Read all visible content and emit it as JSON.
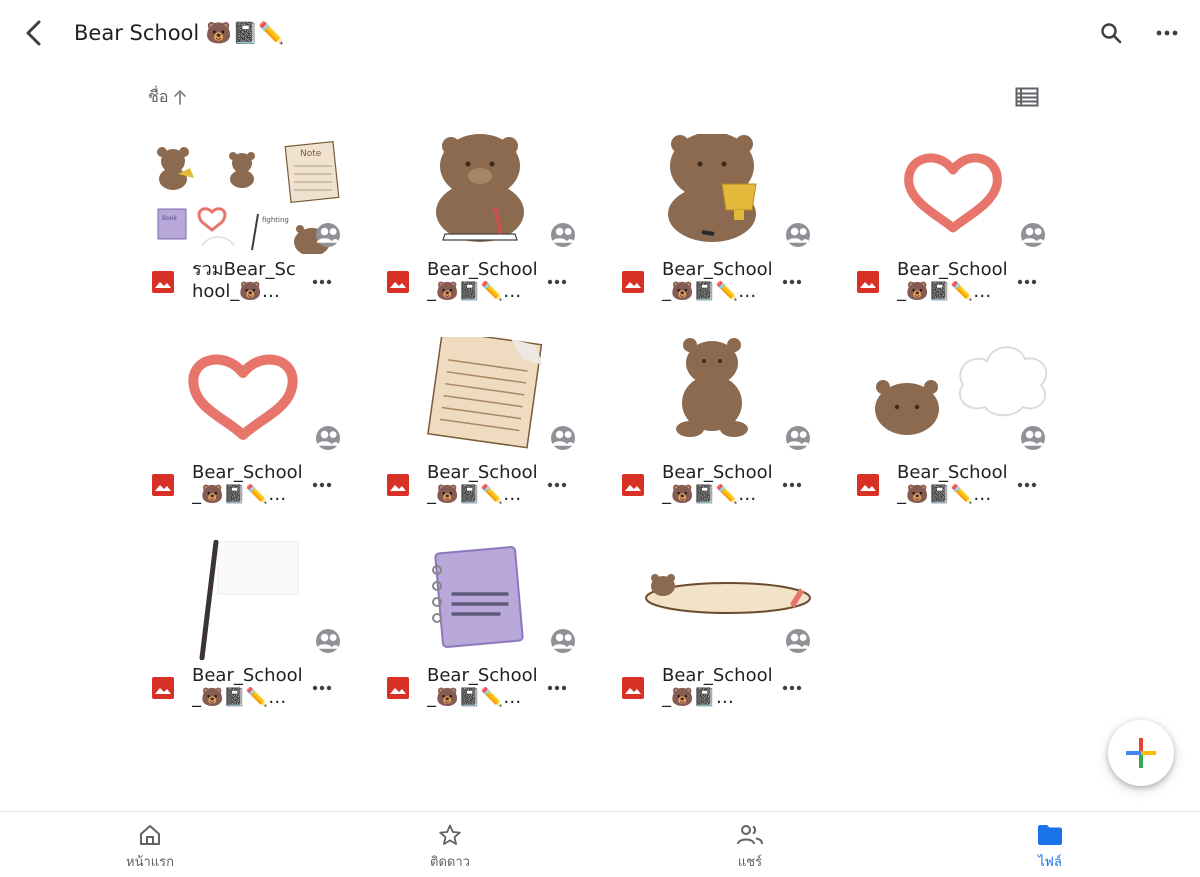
{
  "header": {
    "title": "Bear School 🐻📓✏️"
  },
  "sort": {
    "label": "ชื่อ",
    "direction": "ascending"
  },
  "files": [
    {
      "name": "รวมBear_School_🐻…",
      "thumb": "collage"
    },
    {
      "name": "Bear_School_🐻📓✏️…",
      "thumb": "bear-book"
    },
    {
      "name": "Bear_School_🐻📓✏️…",
      "thumb": "bear-trophy"
    },
    {
      "name": "Bear_School_🐻📓✏️…",
      "thumb": "heart-cha"
    },
    {
      "name": "Bear_School_🐻📓✏️…",
      "thumb": "heart-aan"
    },
    {
      "name": "Bear_School_🐻📓✏️…",
      "thumb": "note"
    },
    {
      "name": "Bear_School_🐻📓✏️…",
      "thumb": "bear-sitting"
    },
    {
      "name": "Bear_School_🐻📓✏️…",
      "thumb": "bear-cloud"
    },
    {
      "name": "Bear_School_🐻📓✏️…",
      "thumb": "flag"
    },
    {
      "name": "Bear_School_🐻📓✏️…",
      "thumb": "book"
    },
    {
      "name": "Bear_School_🐻📓…",
      "thumb": "banner"
    }
  ],
  "nav": {
    "home": "หน้าแรก",
    "starred": "ติดดาว",
    "shared": "แชร์",
    "files": "ไฟล์"
  },
  "colors": {
    "accent": "#1a73e8",
    "image_icon": "#d93025",
    "bear": "#8b6a4f",
    "heart": "#e8756b"
  }
}
